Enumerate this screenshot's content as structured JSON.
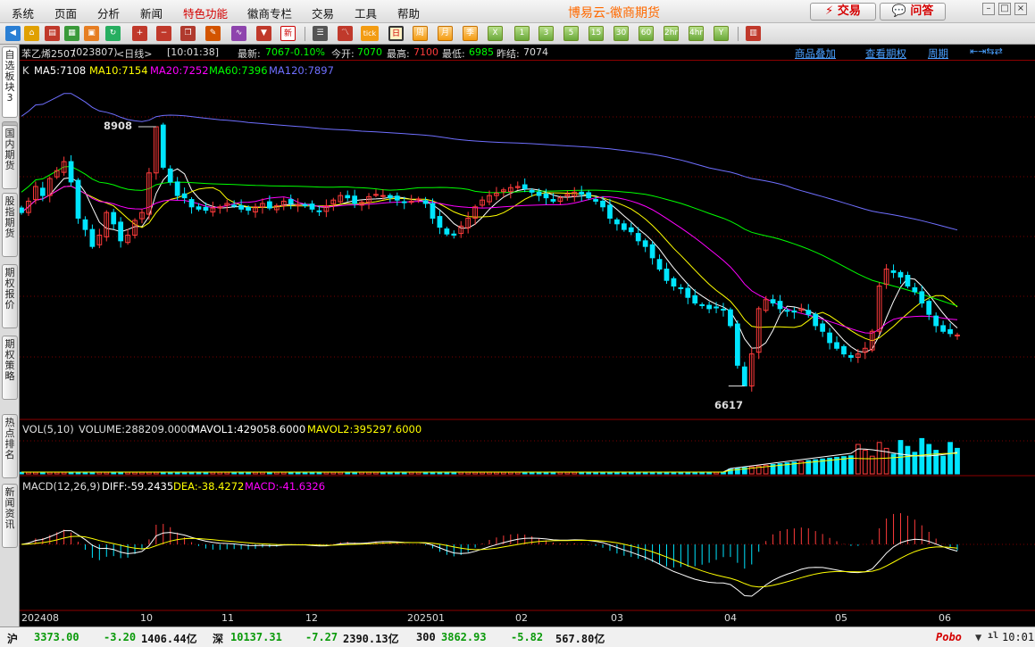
{
  "menu": {
    "items": [
      "系统",
      "页面",
      "分析",
      "新闻",
      "特色功能",
      "徽商专栏",
      "交易",
      "工具",
      "帮助"
    ],
    "title": "博易云-徽商期货",
    "trade_button": "⚡ 交易",
    "qa_button": "💬 问答"
  },
  "toolbar": {
    "periods": [
      "日",
      "周",
      "月",
      "季",
      "X",
      "1",
      "3",
      "5",
      "15",
      "30",
      "60",
      "2hr",
      "4hr",
      "Y"
    ],
    "tick_label": "tick",
    "new_label": "新"
  },
  "left_tabs": [
    "自选板块3",
    "国内期货",
    "股指期货",
    "期权报价",
    "期权策略",
    "热点排名",
    "新闻资讯"
  ],
  "info": {
    "symbol": "苯乙烯2507",
    "code": "(023807)",
    "period": "<日线>",
    "time": "[10:01:38]",
    "latest_label": "最新:",
    "latest": "7067",
    "change": "-0.10%",
    "open_label": "今开:",
    "open": "7070",
    "high_label": "最高:",
    "high": "7100",
    "low_label": "最低:",
    "low": "6985",
    "prev_label": "昨结:",
    "prev": "7074",
    "links": [
      "商品叠加",
      "查看期权",
      "周期"
    ]
  },
  "ma_header": {
    "k": "K",
    "ma5": "MA5:7108",
    "ma10": "MA10:7154",
    "ma20": "MA20:7252",
    "ma60": "MA60:7396",
    "ma120": "MA120:7897"
  },
  "annotations": {
    "high": "8908",
    "low": "6617"
  },
  "vol_header": {
    "title": "VOL(5,10)",
    "volume": "VOLUME:288209.0000",
    "mavol1": "MAVOL1:429058.6000",
    "mavol2": "MAVOL2:395297.6000"
  },
  "macd_header": {
    "title": "MACD(12,26,9)",
    "diff": "DIFF:-59.2435",
    "dea": "DEA:-38.4272",
    "macd": "MACD:-41.6326"
  },
  "x_axis": [
    "202408",
    "10",
    "11",
    "12",
    "202501",
    "02",
    "03",
    "04",
    "05",
    "06"
  ],
  "colors": {
    "up": "#ff3b3b",
    "down": "#00e5ff",
    "ma5": "#ffffff",
    "ma10": "#ffff00",
    "ma20": "#ff00ff",
    "ma60": "#00ff00",
    "ma120": "#6f6fff"
  },
  "status": {
    "sh_label": "沪",
    "sh_index": "3373.00",
    "sh_change": "-3.20",
    "sh_amount": "1406.44亿",
    "sz_label": "深",
    "sz_index": "10137.31",
    "sz_change": "-7.27",
    "sz_amount": "2390.13亿",
    "c300_label": "300",
    "c300_index": "3862.93",
    "c300_change": "-5.82",
    "c300_amount": "567.80亿",
    "brand": "Pobo",
    "clock": "10:01"
  },
  "chart_data": {
    "type": "candlestick",
    "range": [
      "2024-08",
      "2025-06"
    ],
    "price_high": 8908,
    "price_low": 6617,
    "latest": {
      "open": 7070,
      "high": 7100,
      "low": 6985,
      "close": 7067
    },
    "ma_latest": {
      "ma5": 7108,
      "ma10": 7154,
      "ma20": 7252,
      "ma60": 7396,
      "ma120": 7897
    },
    "series_close": [
      8150,
      8250,
      8380,
      8300,
      8450,
      8520,
      8600,
      8420,
      8100,
      8000,
      7850,
      7950,
      8150,
      8050,
      7900,
      7950,
      8080,
      8150,
      8500,
      8908,
      8550,
      8420,
      8300,
      8280,
      8200,
      8180,
      8170,
      8190,
      8200,
      8230,
      8210,
      8180,
      8170,
      8200,
      8230,
      8190,
      8210,
      8250,
      8230,
      8220,
      8210,
      8180,
      8160,
      8210,
      8260,
      8300,
      8280,
      8230,
      8240,
      8290,
      8310,
      8300,
      8280,
      8260,
      8240,
      8250,
      8270,
      8230,
      8100,
      8020,
      7960,
      7950,
      8030,
      8100,
      8200,
      8260,
      8300,
      8320,
      8350,
      8370,
      8380,
      8360,
      8330,
      8300,
      8280,
      8250,
      8280,
      8310,
      8330,
      8310,
      8280,
      8250,
      8200,
      8100,
      8050,
      8000,
      7980,
      7900,
      7850,
      7750,
      7650,
      7550,
      7500,
      7480,
      7400,
      7350,
      7330,
      7300,
      7310,
      7290,
      7150,
      6800,
      6617,
      6900,
      7300,
      7380,
      7350,
      7300,
      7280,
      7270,
      7300,
      7250,
      7150,
      7100,
      7000,
      6950,
      6900,
      6870,
      6900,
      6950,
      7100,
      7500,
      7650,
      7620,
      7580,
      7500,
      7450,
      7350,
      7250,
      7150,
      7100,
      7080,
      7067
    ],
    "macd_latest": {
      "diff": -59.2435,
      "dea": -38.4272,
      "macd": -41.6326
    },
    "volume_latest": {
      "volume": 288209,
      "mavol1": 429058.6,
      "mavol2": 395297.6
    }
  }
}
